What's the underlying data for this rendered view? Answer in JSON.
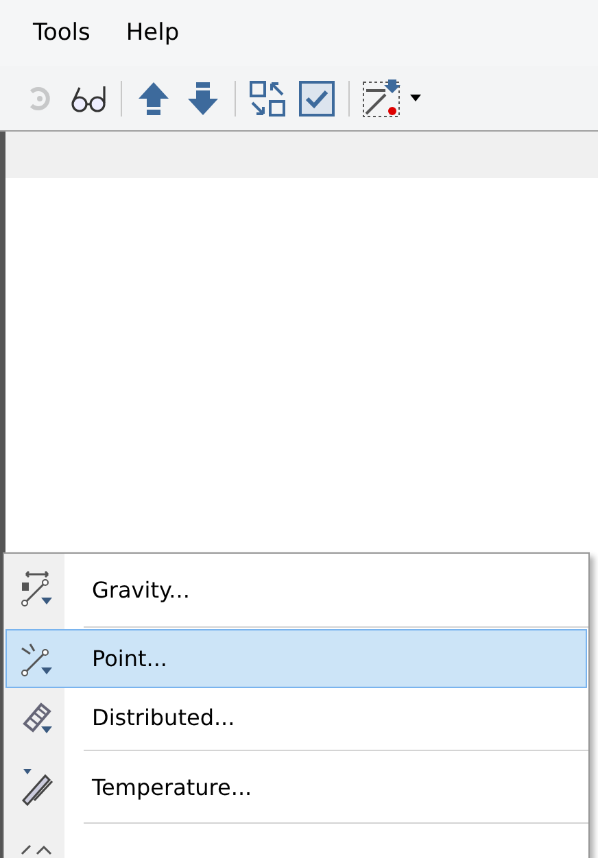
{
  "menu_bar": [
    "Tools",
    "Help"
  ],
  "toolbar": [
    {
      "kind": "redo",
      "disabled": true
    },
    {
      "kind": "glasses",
      "disabled": false
    },
    {
      "kind": "separator"
    },
    {
      "kind": "up",
      "disabled": false
    },
    {
      "kind": "down",
      "disabled": false
    },
    {
      "kind": "separator"
    },
    {
      "kind": "swap",
      "disabled": false
    },
    {
      "kind": "check",
      "disabled": false
    },
    {
      "kind": "separator"
    },
    {
      "kind": "load",
      "disabled": false
    },
    {
      "kind": "caret",
      "disabled": false
    }
  ],
  "context_menu": [
    {
      "kind": "gravity",
      "label": "Gravity...",
      "selected": false
    },
    {
      "kind": "separator"
    },
    {
      "kind": "point",
      "label": "Point...",
      "selected": true
    },
    {
      "kind": "distributed",
      "label": "Distributed...",
      "selected": false
    },
    {
      "kind": "separator"
    },
    {
      "kind": "temperature",
      "label": "Temperature...",
      "selected": false
    },
    {
      "kind": "separator"
    },
    {
      "kind": "strain",
      "selected": false
    }
  ]
}
